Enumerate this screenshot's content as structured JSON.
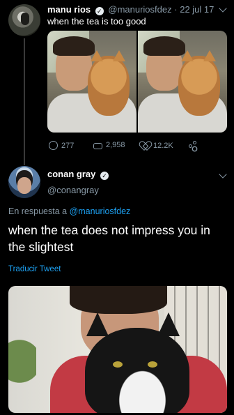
{
  "tweet1": {
    "name": "manu rios",
    "handle": "@manuriosfdez",
    "separator": "·",
    "date": "22 jul 17",
    "text": "when the tea is too good",
    "stats": {
      "replies": "277",
      "retweets": "2,958",
      "likes": "12.2K"
    }
  },
  "tweet2": {
    "name": "conan gray",
    "handle": "@conangray",
    "reply_prefix": "En respuesta a",
    "reply_to": "@manuriosfdez",
    "text": "when the tea does not impress you in the slightest",
    "translate": "Traducir Tweet"
  },
  "icons": {
    "verified": "verified-badge-icon",
    "chevron": "chevron-down-icon",
    "reply": "reply-icon",
    "retweet": "retweet-icon",
    "like": "heart-icon",
    "share": "share-icon"
  },
  "colors": {
    "background": "#000000",
    "muted": "#8899a6",
    "link": "#1da1f2",
    "text": "#ffffff"
  }
}
